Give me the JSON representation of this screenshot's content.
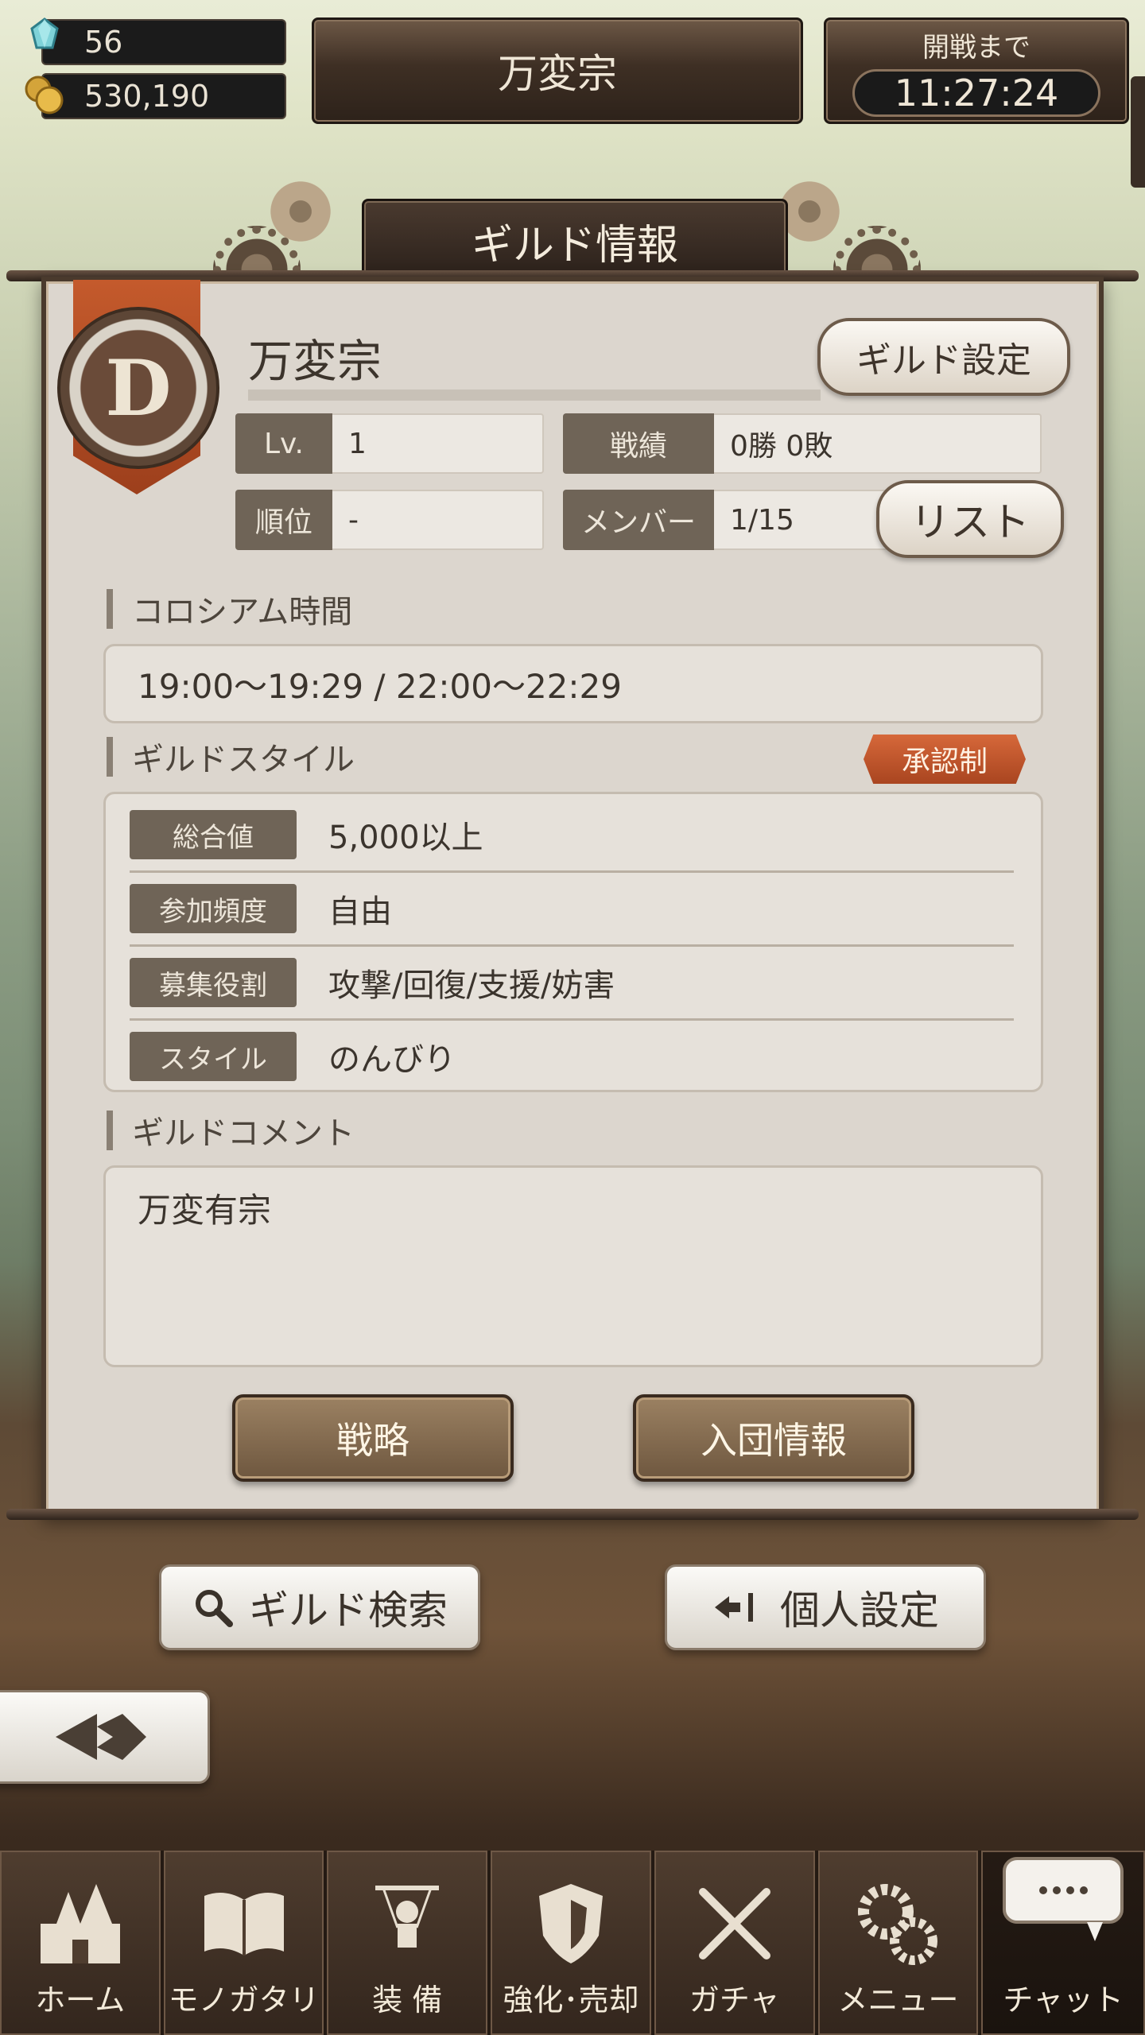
{
  "hud": {
    "gems": "56",
    "coins": "530,190",
    "guild_name_top": "万変宗",
    "battle_label": "開戦まで",
    "battle_time": "11:27:24"
  },
  "panel": {
    "title": "ギルド情報",
    "emblem_letter": "D",
    "guild_name": "万変宗",
    "settings_button": "ギルド設定",
    "stats": {
      "lv_label": "Lv.",
      "lv_value": "1",
      "record_label": "戦績",
      "record_value": "0勝  0敗",
      "rank_label": "順位",
      "rank_value": "-",
      "member_label": "メンバー",
      "member_value": "1/15",
      "list_button": "リスト"
    },
    "colosseum": {
      "heading": "コロシアム時間",
      "times": "19:00～19:29  /  22:00～22:29"
    },
    "style": {
      "heading": "ギルドスタイル",
      "badge": "承認制",
      "rows": [
        {
          "label": "総合値",
          "value": "5,000以上"
        },
        {
          "label": "参加頻度",
          "value": "自由"
        },
        {
          "label": "募集役割",
          "value": "攻撃/回復/支援/妨害"
        },
        {
          "label": "スタイル",
          "value": "のんびり"
        }
      ]
    },
    "comment": {
      "heading": "ギルドコメント",
      "text": "万変有宗"
    },
    "buttons": {
      "strategy": "戦略",
      "join_info": "入団情報"
    }
  },
  "actions": {
    "guild_search": "ギルド検索",
    "personal_settings": "個人設定"
  },
  "nav": {
    "items": [
      {
        "label": "ホーム",
        "icon": "castle-icon"
      },
      {
        "label": "モノガタリ",
        "icon": "book-icon"
      },
      {
        "label": "装 備",
        "icon": "puppet-icon"
      },
      {
        "label": "強化･売却",
        "icon": "shield-icon"
      },
      {
        "label": "ガチャ",
        "icon": "swords-icon"
      },
      {
        "label": "メニュー",
        "icon": "gears-icon"
      },
      {
        "label": "チャット",
        "icon": "chat-icon"
      }
    ]
  },
  "colors": {
    "badge": "#c8542a",
    "panel_bg": "#dcd6ce",
    "label_bg": "#6f6457"
  }
}
